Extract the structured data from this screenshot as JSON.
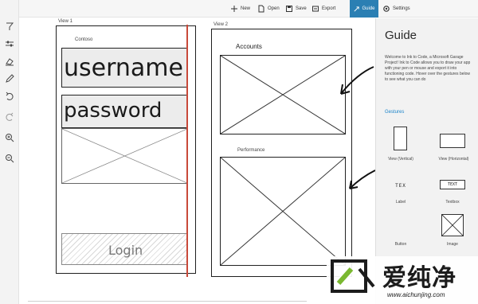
{
  "toolbar": {
    "new_label": "New",
    "open_label": "Open",
    "save_label": "Save",
    "export_label": "Export",
    "guide_label": "Guide",
    "settings_label": "Settings"
  },
  "tools": [
    "select-icon",
    "adjust-icon",
    "eraser-icon",
    "pen-icon",
    "undo-icon",
    "redo-icon",
    "zoom-in-icon",
    "zoom-out-icon"
  ],
  "canvas": {
    "view1": {
      "label": "View 1",
      "brand": "Contoso",
      "username": "username",
      "password": "password",
      "login": "Login"
    },
    "view2": {
      "label": "View 2",
      "accounts": "Accounts",
      "performance": "Performance"
    }
  },
  "guide": {
    "title": "Guide",
    "intro": "Welcome to Ink to Code, a Microsoft Garage Project! Ink to Code allows you to draw your app with your pen or mouse and export it into functioning code. Hover over the gestures below to see what you can do",
    "gestures_heading": "Gestures",
    "items": [
      {
        "label": "View (Vertical)"
      },
      {
        "label": "View (Horizontal)"
      },
      {
        "label": "Label",
        "glyph": "TEX"
      },
      {
        "label": "Textbox",
        "glyph": "TEXT"
      },
      {
        "label": "Button"
      },
      {
        "label": "Image"
      }
    ]
  },
  "watermark": {
    "chinese": "爱纯净",
    "url": "www.aichunjing.com"
  },
  "colors": {
    "accent": "#2b7fb3",
    "link": "#1a83c9",
    "red_guide": "#c9493a"
  }
}
